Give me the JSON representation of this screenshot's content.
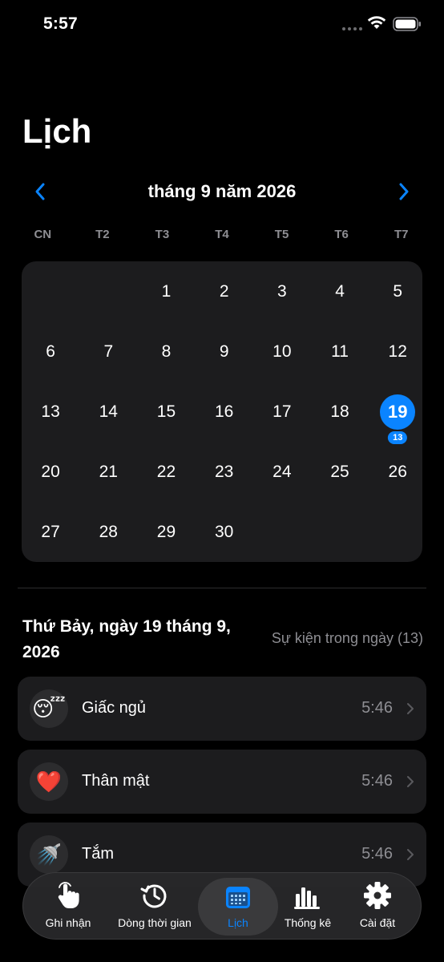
{
  "status_bar": {
    "time": "5:57"
  },
  "page_title": "Lịch",
  "month_nav": {
    "label": "tháng 9 năm 2026"
  },
  "weekdays": [
    "CN",
    "T2",
    "T3",
    "T4",
    "T5",
    "T6",
    "T7"
  ],
  "calendar": {
    "leading_blanks": 2,
    "days": [
      "1",
      "2",
      "3",
      "4",
      "5",
      "6",
      "7",
      "8",
      "9",
      "10",
      "11",
      "12",
      "13",
      "14",
      "15",
      "16",
      "17",
      "18",
      "19",
      "20",
      "21",
      "22",
      "23",
      "24",
      "25",
      "26",
      "27",
      "28",
      "29",
      "30"
    ],
    "selected_day": "19",
    "selected_badge": "13"
  },
  "day_header": {
    "title": "Thứ Bảy, ngày 19 tháng 9, 2026",
    "events_label": "Sự kiện trong ngày (13)"
  },
  "events": [
    {
      "name": "Giấc ngủ",
      "time": "5:46",
      "icon": "sleeping-face-icon",
      "glyph": "😴"
    },
    {
      "name": "Thân mật",
      "time": "5:46",
      "icon": "heart-icon",
      "glyph": "❤️"
    },
    {
      "name": "Tắm",
      "time": "5:46",
      "icon": "shower-icon",
      "glyph": "🚿"
    }
  ],
  "tabs": [
    {
      "label": "Ghi nhận",
      "icon": "tap-hand-icon"
    },
    {
      "label": "Dòng thời gian",
      "icon": "history-clock-icon"
    },
    {
      "label": "Lịch",
      "icon": "calendar-icon",
      "active": true
    },
    {
      "label": "Thống kê",
      "icon": "bar-chart-icon"
    },
    {
      "label": "Cài đặt",
      "icon": "gear-icon"
    }
  ],
  "colors": {
    "accent": "#0a84ff",
    "background": "#000000",
    "card": "#1c1c1e",
    "secondary_text": "#8e8e93"
  }
}
